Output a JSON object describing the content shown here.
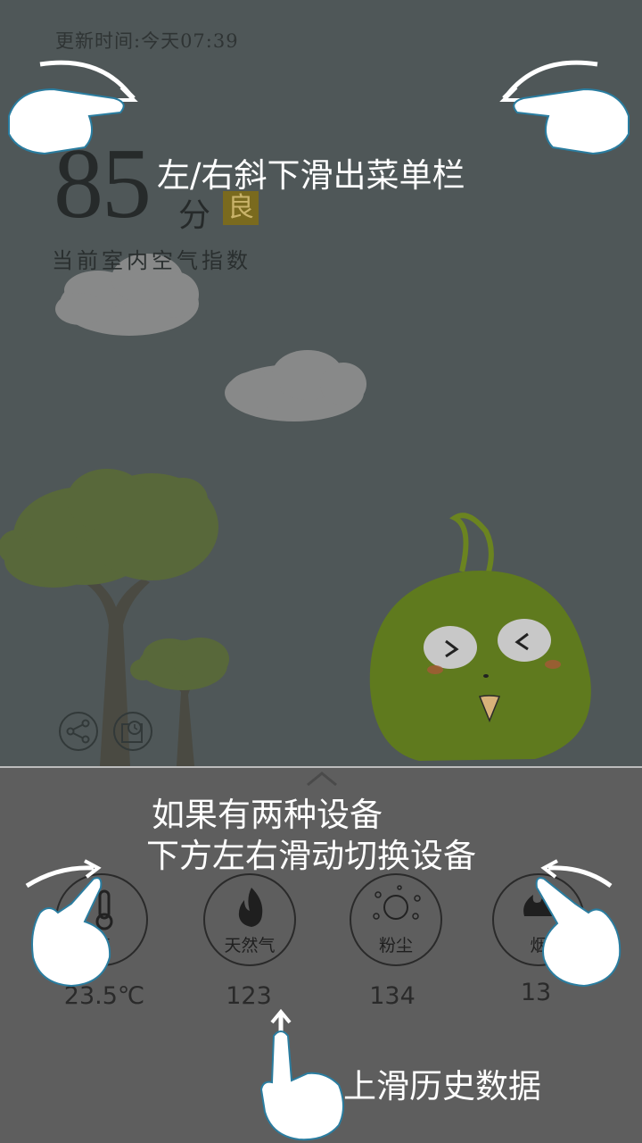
{
  "header": {
    "update_time": "更新时间:今天07:39"
  },
  "air_quality": {
    "value": "85",
    "unit": "分",
    "level": "良",
    "caption": "当前室内空气指数"
  },
  "colors": {
    "background": "#4f5758",
    "panel": "#5e5e5e",
    "level_badge": "#7a6a1e",
    "mascot": "#5f7a1e",
    "tree": "#58683a"
  },
  "toolbar": {
    "share_icon": "share-icon",
    "history_icon": "history-icon"
  },
  "sensors": [
    {
      "label": "度",
      "icon": "thermometer-icon",
      "reading": "23.5℃"
    },
    {
      "label": "天然气",
      "icon": "flame-icon",
      "reading": "123"
    },
    {
      "label": "粉尘",
      "icon": "dust-icon",
      "reading": "134"
    },
    {
      "label": "烟",
      "icon": "smoke-icon",
      "reading": "13"
    }
  ],
  "tutorial": {
    "menu_hint": "左/右斜下滑出菜单栏",
    "device_hint_line1": "如果有两种设备",
    "device_hint_line2": "下方左右滑动切换设备",
    "history_hint": "上滑历史数据"
  }
}
